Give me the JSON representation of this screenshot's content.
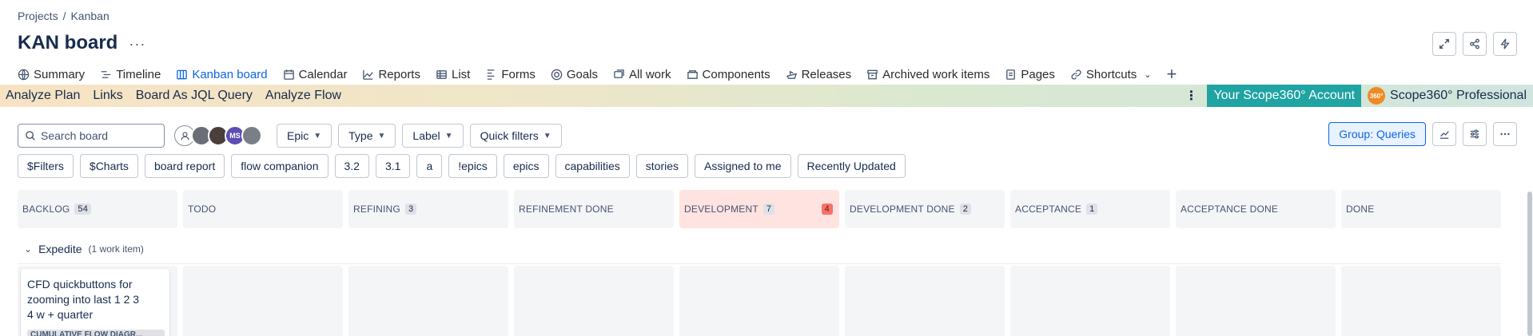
{
  "breadcrumb": {
    "projects": "Projects",
    "separator": "/",
    "current": "Kanban"
  },
  "header": {
    "title": "KAN board",
    "more_label": "···"
  },
  "top_actions": [
    {
      "name": "expand-icon"
    },
    {
      "name": "share-icon"
    },
    {
      "name": "automation-icon"
    }
  ],
  "tabs": [
    {
      "label": "Summary",
      "icon": "globe-icon"
    },
    {
      "label": "Timeline",
      "icon": "timeline-icon"
    },
    {
      "label": "Kanban board",
      "icon": "board-icon",
      "active": true
    },
    {
      "label": "Calendar",
      "icon": "calendar-icon"
    },
    {
      "label": "Reports",
      "icon": "chart-icon"
    },
    {
      "label": "List",
      "icon": "list-icon"
    },
    {
      "label": "Forms",
      "icon": "forms-icon"
    },
    {
      "label": "Goals",
      "icon": "target-icon"
    },
    {
      "label": "All work",
      "icon": "stack-icon"
    },
    {
      "label": "Components",
      "icon": "component-icon"
    },
    {
      "label": "Releases",
      "icon": "ship-icon"
    },
    {
      "label": "Archived work items",
      "icon": "archive-icon"
    },
    {
      "label": "Pages",
      "icon": "page-icon"
    },
    {
      "label": "Shortcuts",
      "icon": "link-icon"
    }
  ],
  "plugin_bar": {
    "links": [
      "Analyze Plan",
      "Links",
      "Board As JQL Query",
      "Analyze Flow"
    ],
    "account": "Your Scope360° Account",
    "logo_text": "360°",
    "product": "Scope360° Professional"
  },
  "toolbar": {
    "search_placeholder": "Search board",
    "avatar_ms": "MS",
    "filters": [
      "Epic",
      "Type",
      "Label",
      "Quick filters"
    ],
    "group_label": "Group: Queries"
  },
  "chips": [
    "$Filters",
    "$Charts",
    "board report",
    "flow companion",
    "3.2",
    "3.1",
    "a",
    "!epics",
    "epics",
    "capabilities",
    "stories",
    "Assigned to me",
    "Recently Updated"
  ],
  "columns": [
    {
      "title": "BACKLOG",
      "count": "54"
    },
    {
      "title": "TODO",
      "count": ""
    },
    {
      "title": "REFINING",
      "count": "3"
    },
    {
      "title": "REFINEMENT DONE",
      "count": ""
    },
    {
      "title": "DEVELOPMENT",
      "count": "7",
      "wip": "4"
    },
    {
      "title": "DEVELOPMENT DONE",
      "count": "2"
    },
    {
      "title": "ACCEPTANCE",
      "count": "1"
    },
    {
      "title": "ACCEPTANCE DONE",
      "count": ""
    },
    {
      "title": "DONE",
      "count": ""
    }
  ],
  "swimlane": {
    "title": "Expedite",
    "count_label": "(1 work item)"
  },
  "card": {
    "title": "CFD quickbuttons for zooming into last 1 2 3 4 w + quarter",
    "tag": "CUMULATIVE FLOW DIAGR..."
  },
  "colors": {
    "accent": "#0c66e4",
    "plugin_teal": "#1fa3a3",
    "alert_bg": "#ffe3e1",
    "wip_red": "#f87168"
  }
}
